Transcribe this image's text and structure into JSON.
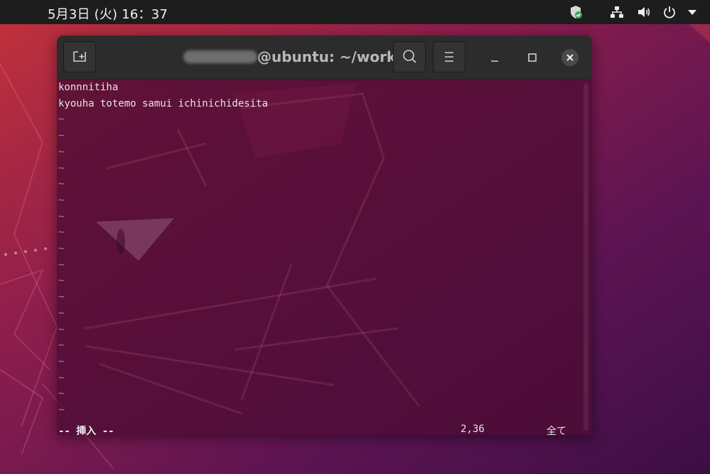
{
  "topbar": {
    "clock": "5月3日 (火)  16：37",
    "icons": [
      "shield-update-icon",
      "network-icon",
      "volume-icon",
      "power-icon",
      "chevron-down-icon"
    ]
  },
  "terminal": {
    "title": "@ubuntu: ~/work",
    "buttons": {
      "new_tab": "new-tab-icon",
      "search": "search-icon",
      "menu": "menu-icon",
      "minimize": "minimize-icon",
      "maximize": "maximize-icon",
      "close": "close-icon"
    },
    "lines": [
      "konnnitiha",
      "kyouha totemo samui ichinichidesita"
    ],
    "tilde": "~",
    "status": {
      "mode": "-- 挿入 --",
      "position": "2,36",
      "scope": "全て"
    }
  },
  "colors": {
    "topbar": "#1d1d1d",
    "headerbar": "#2c2c2c",
    "terminal_bg": "#4e0c34",
    "accent": "#e95420"
  }
}
